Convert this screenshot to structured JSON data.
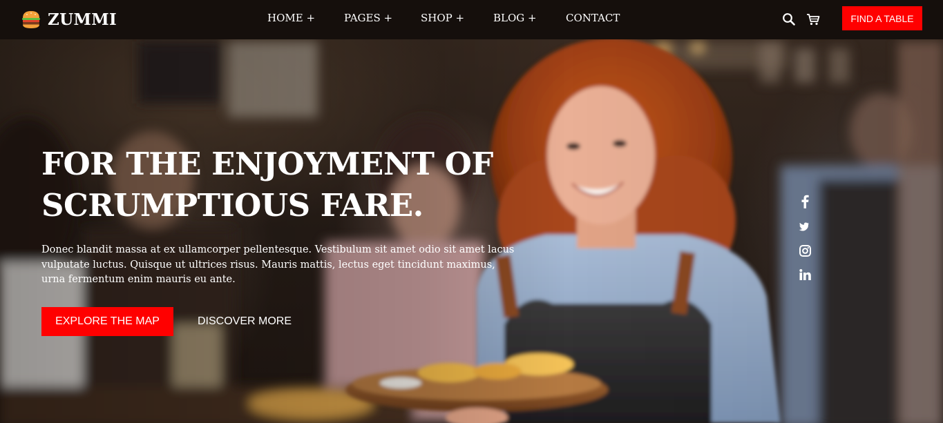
{
  "brand": {
    "name": "ZUMMI",
    "logo_icon": "burger-icon"
  },
  "nav": {
    "items": [
      {
        "label": "HOME +"
      },
      {
        "label": "PAGES +"
      },
      {
        "label": "SHOP +"
      },
      {
        "label": "BLOG +"
      },
      {
        "label": "CONTACT"
      }
    ]
  },
  "header_actions": {
    "search_icon": "search-icon",
    "cart_icon": "cart-icon",
    "cta_label": "FIND A TABLE"
  },
  "hero": {
    "title_line_1": "FOR THE ENJOYMENT OF",
    "title_line_2": "SCRUMPTIOUS FARE.",
    "text": "Donec blandit massa at ex ullamcorper pellentesque. Vestibulum sit amet odio sit amet lacus vulputate luctus. Quisque ut ultrices risus. Mauris mattis, lectus eget tincidunt maximus, urna fermentum enim mauris eu ante.",
    "primary_button": "EXPLORE THE MAP",
    "secondary_button": "DISCOVER MORE",
    "background_image": "smiling-waitress-serving-food-in-restaurant"
  },
  "social": {
    "icons": [
      "facebook-icon",
      "twitter-icon",
      "instagram-icon",
      "linkedin-icon"
    ]
  },
  "colors": {
    "accent": "#ff0000",
    "header_bg": "#150f0c",
    "text": "#ffffff"
  }
}
